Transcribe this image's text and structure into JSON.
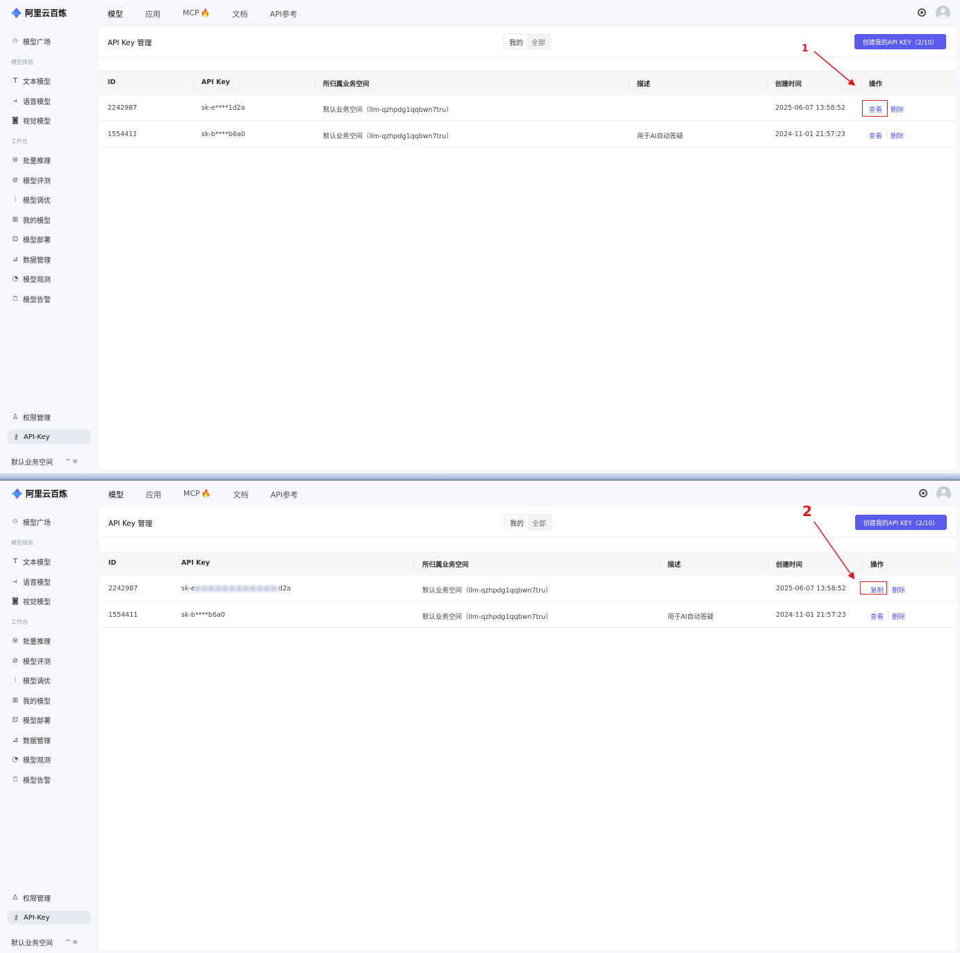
{
  "app": {
    "name": "阿里云百炼"
  },
  "nav": {
    "tabs": [
      "模型",
      "应用",
      "MCP",
      "文档",
      "API参考"
    ],
    "flame_icon": "flame-icon"
  },
  "sidebar": {
    "items_top": [
      {
        "label": "模型广场",
        "icon": "cube-icon"
      }
    ],
    "section1": "模型体验",
    "items_exp": [
      {
        "label": "文本模型",
        "icon": "text-icon"
      },
      {
        "label": "语音模型",
        "icon": "audio-icon"
      },
      {
        "label": "视觉模型",
        "icon": "camera-icon"
      }
    ],
    "section2": "工作台",
    "items_work": [
      {
        "label": "批量推理",
        "icon": "batch-icon"
      },
      {
        "label": "模型评测",
        "icon": "compass-icon"
      },
      {
        "label": "模型调优",
        "icon": "sliders-icon"
      },
      {
        "label": "我的模型",
        "icon": "grid-icon"
      },
      {
        "label": "模型部署",
        "icon": "deploy-icon"
      },
      {
        "label": "数据管理",
        "icon": "chart-icon"
      },
      {
        "label": "模型观测",
        "icon": "pie-icon"
      },
      {
        "label": "模型告警",
        "icon": "alarm-icon"
      }
    ],
    "items_bottom": [
      {
        "label": "权限管理",
        "icon": "user-icon"
      },
      {
        "label": "API-Key",
        "icon": "key-icon"
      }
    ],
    "workspace": "默认业务空间",
    "workspace_ctrl": "^  ≡"
  },
  "main": {
    "title": "API Key 管理",
    "seg": [
      "我的",
      "全部"
    ],
    "create_btn": "创建我的API KEY（2/10）",
    "columns": [
      "ID",
      "API Key",
      "所归属业务空间",
      "描述",
      "创建时间",
      "操作"
    ]
  },
  "panel1": {
    "rows": [
      {
        "id": "2242987",
        "key": "sk-e****1d2a",
        "ws": "默认业务空间（llm-qzhpdg1qqbwn7tru）",
        "desc": "",
        "time": "2025-06-07 13:58:52",
        "op1": "查看",
        "op2": "删除"
      },
      {
        "id": "1554411",
        "key": "sk-b****b6a0",
        "ws": "默认业务空间（llm-qzhpdg1qqbwn7tru）",
        "desc": "用于AI自动答疑",
        "time": "2024-11-01 21:57:23",
        "op1": "查看",
        "op2": "删除"
      }
    ]
  },
  "panel2": {
    "rows": [
      {
        "id": "2242987",
        "key_prefix": "sk-e",
        "key_suffix": "d2a",
        "ws": "默认业务空间（llm-qzhpdg1qqbwn7tru）",
        "desc": "",
        "time": "2025-06-07 13:58:52",
        "op1": "复制",
        "op2": "删除"
      },
      {
        "id": "1554411",
        "key": "sk-b****b6a0",
        "ws": "默认业务空间（llm-qzhpdg1qqbwn7tru）",
        "desc": "用于AI自动答疑",
        "time": "2024-11-01 21:57:23",
        "op1": "查看",
        "op2": "删除"
      }
    ]
  },
  "annotations": {
    "step1": "1",
    "step2": "2",
    "color": "#e3161b"
  }
}
